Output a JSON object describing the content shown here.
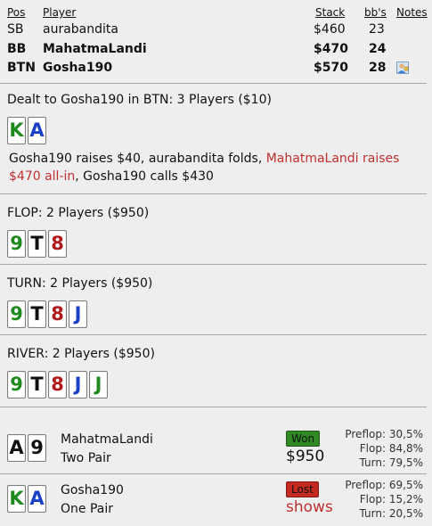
{
  "header": {
    "pos": "Pos",
    "player": "Player",
    "stack": "Stack",
    "bbs": "bb's",
    "notes": "Notes"
  },
  "players": [
    {
      "pos": "SB",
      "name": "aurabandita",
      "stack": "$460",
      "bbs": "23",
      "bold": false
    },
    {
      "pos": "BB",
      "name": "MahatmaLandi",
      "stack": "$470",
      "bbs": "24",
      "bold": true
    },
    {
      "pos": "BTN",
      "name": "Gosha190",
      "stack": "$570",
      "bbs": "28",
      "bold": true,
      "note_icon": "player-note-icon"
    }
  ],
  "preflop": {
    "title": "Dealt to Gosha190 in BTN: 3 Players ($10)",
    "hole_cards": [
      {
        "rank": "K",
        "color": "green"
      },
      {
        "rank": "A",
        "color": "blue"
      }
    ],
    "action_part1": "Gosha190 raises $40, aurabandita folds, ",
    "action_red": "MahatmaLandi raises $470 all-in",
    "action_part2": ", Gosha190 calls $430"
  },
  "flop": {
    "title": "FLOP: 2 Players ($950)",
    "cards": [
      {
        "rank": "9",
        "color": "green"
      },
      {
        "rank": "T",
        "color": "black"
      },
      {
        "rank": "8",
        "color": "red"
      }
    ]
  },
  "turn": {
    "title": "TURN: 2 Players ($950)",
    "cards": [
      {
        "rank": "9",
        "color": "green"
      },
      {
        "rank": "T",
        "color": "black"
      },
      {
        "rank": "8",
        "color": "red"
      },
      {
        "rank": "J",
        "color": "blue"
      }
    ]
  },
  "river": {
    "title": "RIVER: 2 Players ($950)",
    "cards": [
      {
        "rank": "9",
        "color": "green"
      },
      {
        "rank": "T",
        "color": "black"
      },
      {
        "rank": "8",
        "color": "red"
      },
      {
        "rank": "J",
        "color": "blue"
      },
      {
        "rank": "J",
        "color": "green"
      }
    ]
  },
  "results": [
    {
      "name": "MahatmaLandi",
      "hand": "Two Pair",
      "cards": [
        {
          "rank": "A",
          "color": "black"
        },
        {
          "rank": "9",
          "color": "black"
        }
      ],
      "badge": "Won",
      "badge_type": "won",
      "amount": "$950",
      "equity": [
        {
          "label": "Preflop:",
          "value": "30,5%"
        },
        {
          "label": "Flop:",
          "value": "84,8%"
        },
        {
          "label": "Turn:",
          "value": "79,5%"
        }
      ]
    },
    {
      "name": "Gosha190",
      "hand": "One Pair",
      "cards": [
        {
          "rank": "K",
          "color": "green"
        },
        {
          "rank": "A",
          "color": "blue"
        }
      ],
      "badge": "Lost",
      "badge_type": "lost",
      "amount": "shows",
      "equity": [
        {
          "label": "Preflop:",
          "value": "69,5%"
        },
        {
          "label": "Flop:",
          "value": "15,2%"
        },
        {
          "label": "Turn:",
          "value": "20,5%"
        }
      ]
    }
  ],
  "colors": {
    "green": "#1e8a1e",
    "blue": "#1c3fc8",
    "red": "#b01a1a",
    "black": "#111111",
    "action_red": "#c03030",
    "won": "#2f8a24",
    "lost": "#c42a1f"
  }
}
